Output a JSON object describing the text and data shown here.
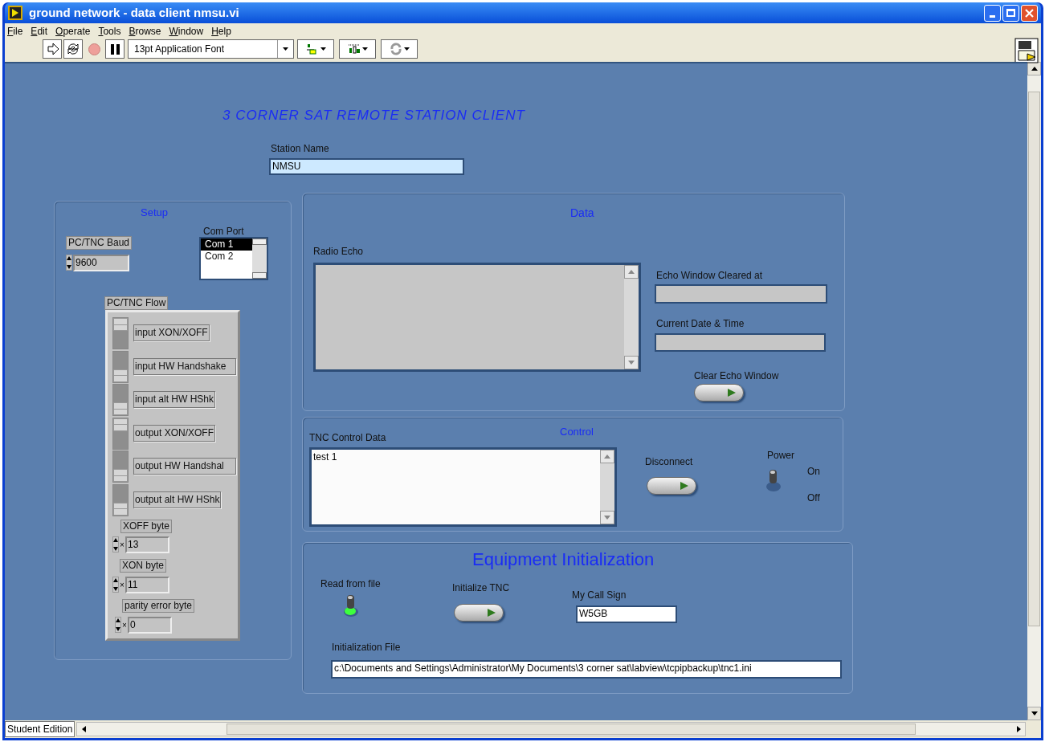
{
  "window": {
    "title": "ground network - data client nmsu.vi"
  },
  "menu": [
    "File",
    "Edit",
    "Operate",
    "Tools",
    "Browse",
    "Window",
    "Help"
  ],
  "toolbar": {
    "buttons": [
      {
        "kind": "run",
        "disabled": false
      },
      {
        "kind": "run-continuous",
        "disabled": false
      },
      {
        "kind": "abort",
        "disabled": true
      },
      {
        "kind": "pause",
        "disabled": false
      }
    ],
    "font": "13pt Application Font"
  },
  "panel": {
    "title": "3 CORNER SAT REMOTE STATION CLIENT",
    "station_name": {
      "label": "Station Name",
      "value": "NMSU"
    },
    "setup": {
      "title": "Setup",
      "com_port": {
        "label": "Com Port",
        "items": [
          {
            "label": "Com 1",
            "selected": true
          },
          {
            "label": "Com 2",
            "selected": false
          }
        ]
      },
      "baud": {
        "label": "PC/TNC Baud",
        "value": "9600"
      },
      "flow": {
        "label": "PC/TNC Flow",
        "switches": [
          {
            "label": "input XON/XOFF",
            "on": true
          },
          {
            "label": "input HW Handshake",
            "on": false
          },
          {
            "label": "input alt HW HShk",
            "on": false
          },
          {
            "label": "output XON/XOFF",
            "on": true
          },
          {
            "label": "output HW Handshal",
            "on": false
          },
          {
            "label": "output alt HW HShk",
            "on": false
          }
        ],
        "bytes": [
          {
            "label": "XOFF byte",
            "radix": "×",
            "value": "13"
          },
          {
            "label": "XON byte",
            "radix": "×",
            "value": "11"
          },
          {
            "label": "parity error byte",
            "radix": "×",
            "value": "0"
          }
        ]
      }
    },
    "data": {
      "title": "Data",
      "radio_echo": {
        "label": "Radio Echo"
      },
      "echo_cleared": {
        "label": "Echo Window Cleared at"
      },
      "date_time": {
        "label": "Current Date & Time"
      },
      "clear_button": {
        "label": "Clear Echo Window"
      }
    },
    "control": {
      "title": "Control",
      "tnc_data": {
        "label": "TNC Control Data",
        "value": "test 1"
      },
      "disconnect": {
        "label": "Disconnect"
      },
      "power": {
        "label": "Power",
        "on": true,
        "on_label": "On",
        "off_label": "Off"
      }
    },
    "equipment": {
      "title": "Equipment Initialization",
      "read_from_file": {
        "label": "Read from file",
        "on": true
      },
      "init_button": {
        "label": "Initialize TNC"
      },
      "call_sign": {
        "label": "My Call Sign",
        "value": "W5GB"
      },
      "init_file": {
        "label": "Initialization File",
        "value": "c:\\Documents and Settings\\Administrator\\My Documents\\3 corner sat\\labview\\tcpipbackup\\tnc1.ini"
      }
    }
  },
  "status_bar": {
    "edition": "Student Edition"
  }
}
